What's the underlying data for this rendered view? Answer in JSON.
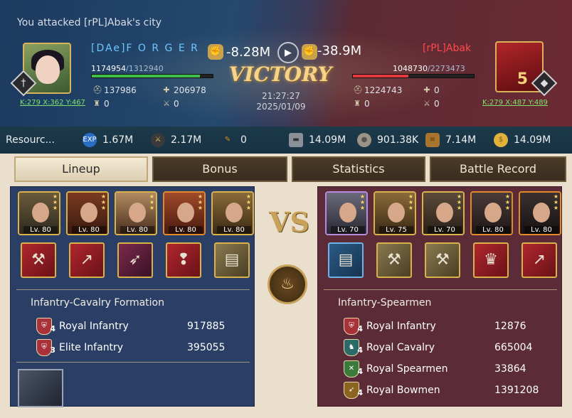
{
  "header": {
    "attack_message": "You attacked [rPL]Abak's city",
    "victory_label": "VICTORY",
    "time": "21:27:27",
    "date": "2025/01/09",
    "left": {
      "name": "[DAe]F O R G E R",
      "hp_current": "1174954",
      "hp_max": "/1312940",
      "hp_fraction": 0.895,
      "loss": "-8.28M",
      "stat_troops": "137986",
      "stat_heal": "206978",
      "stat_wall": "0",
      "stat_trap": "0",
      "coords": "K:279 X:362 Y:467"
    },
    "right": {
      "name": "[rPL]Abak",
      "hp_current": "1048730",
      "hp_max": "/2273473",
      "hp_fraction": 0.461,
      "loss": "-38.9M",
      "stat_troops": "1224743",
      "stat_heal": "0",
      "stat_wall": "0",
      "stat_trap": "0",
      "coords": "K:279 X:487 Y:489",
      "level": "5"
    }
  },
  "resources": {
    "label": "Resourc...",
    "exp": "1.67M",
    "kills": "2.17M",
    "feather": "0",
    "iron": "14.09M",
    "stone": "901.38K",
    "wood": "7.14M",
    "gold": "14.09M"
  },
  "tabs": [
    "Lineup",
    "Bonus",
    "Statistics",
    "Battle Record"
  ],
  "vs_label": "VS",
  "left_panel": {
    "heroes": [
      "Lv. 80",
      "Lv. 80",
      "Lv. 80",
      "Lv. 80",
      "Lv. 80"
    ],
    "formation": "Infantry-Cavalry Formation",
    "troops": [
      {
        "name": "Royal Infantry",
        "tier": "4",
        "value": "917885"
      },
      {
        "name": "Elite Infantry",
        "tier": "3",
        "value": "395055"
      }
    ]
  },
  "right_panel": {
    "heroes": [
      "Lv. 70",
      "Lv. 75",
      "Lv. 70",
      "Lv. 80",
      "Lv. 80"
    ],
    "formation": "Infantry-Spearmen",
    "troops": [
      {
        "name": "Royal Infantry",
        "tier": "4",
        "value": "12876"
      },
      {
        "name": "Royal Cavalry",
        "tier": "4",
        "value": "665004"
      },
      {
        "name": "Royal Spearmen",
        "tier": "4",
        "value": "33864"
      },
      {
        "name": "Royal Bowmen",
        "tier": "4",
        "value": "1391208"
      }
    ]
  },
  "icons": {
    "exp": "exp-icon",
    "kills": "swords-icon",
    "feather": "feather-icon",
    "iron": "iron-ingot-icon",
    "stone": "stone-icon",
    "wood": "wood-log-icon",
    "gold": "gold-coin-icon"
  }
}
